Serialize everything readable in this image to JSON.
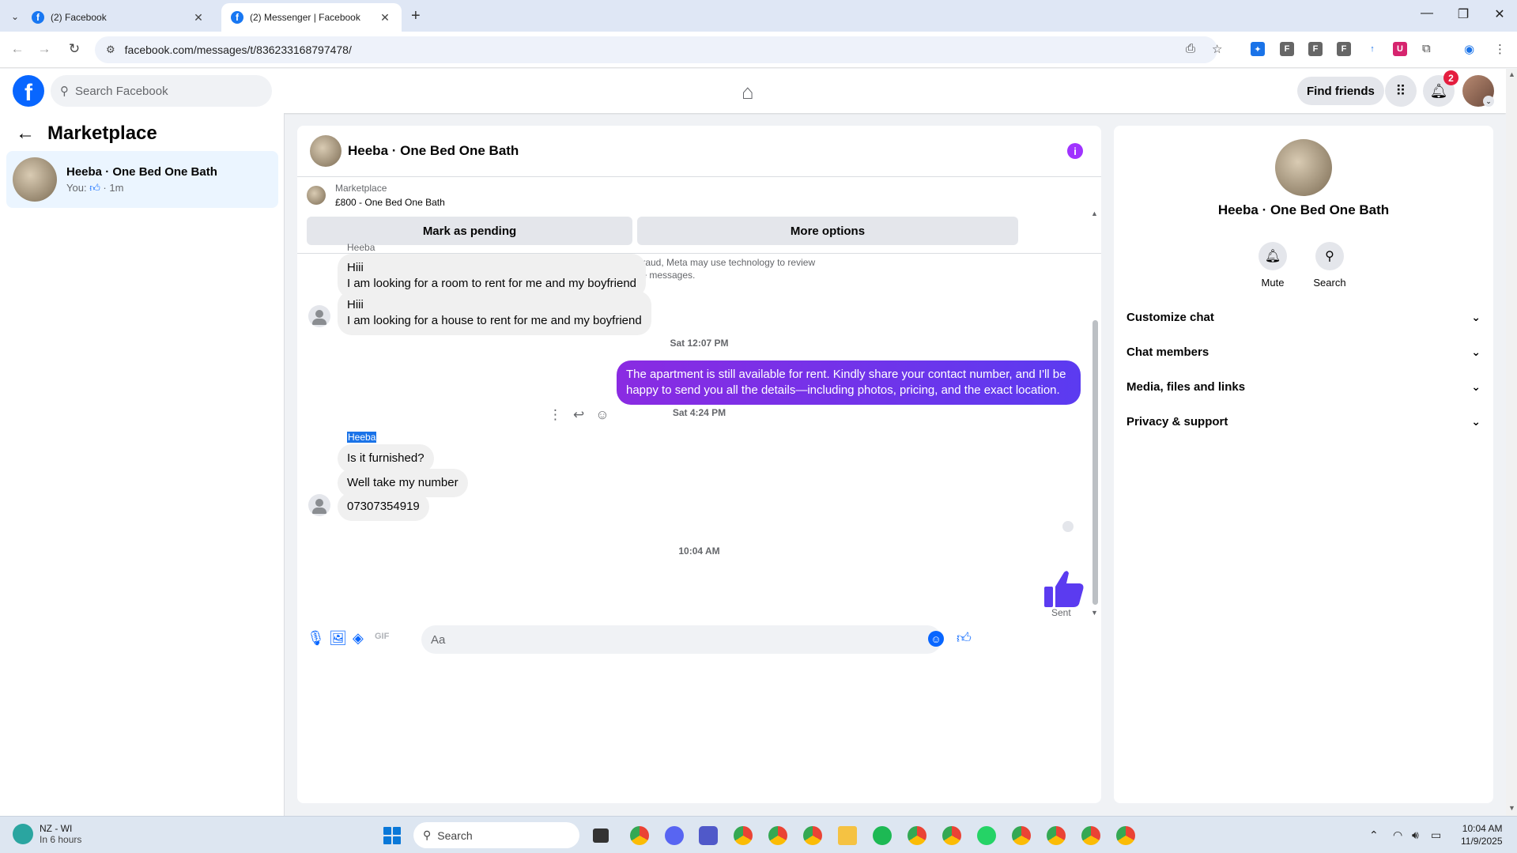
{
  "browser": {
    "tabs": [
      {
        "title": "(2) Facebook",
        "active": false
      },
      {
        "title": "(2) Messenger | Facebook",
        "active": true
      }
    ],
    "url": "facebook.com/messages/t/836233168797478/"
  },
  "fb_nav": {
    "search_placeholder": "Search Facebook",
    "find_friends_label": "Find friends",
    "notification_count": "2"
  },
  "left": {
    "title": "Marketplace",
    "conversation": {
      "name": "Heeba · One Bed One Bath",
      "preview_prefix": "You:",
      "preview_time": "· 1m"
    }
  },
  "chat": {
    "title": "Heeba · One Bed One Bath",
    "listing_label": "Marketplace",
    "listing_price": "£800 - One Bed One Bath",
    "mark_pending_label": "Mark as pending",
    "more_options_label": "More options",
    "notice": "To help identify and reduce scams and fraud, Meta may use technology to review Marketplace messages.",
    "sender1": "Heeba",
    "msg1_line1": "Hiii",
    "msg1_line2": "I am looking for a room to rent for me and my boyfriend",
    "msg2_line1": "Hiii",
    "msg2_line2": "I am looking for a house to rent for me and my boyfriend",
    "time1": "Sat 12:07 PM",
    "out_msg": "The apartment is still available for rent. Kindly share your contact number, and I'll be happy to send you all the details—including photos, pricing, and the exact location.",
    "time2": "Sat 4:24 PM",
    "sender2": "Heeba",
    "msg3": "Is it furnished?",
    "msg4": "Well take my number",
    "msg5": "07307354919",
    "time3": "10:04 AM",
    "sent_label": "Sent",
    "composer_placeholder": "Aa"
  },
  "right": {
    "name": "Heeba · One Bed One Bath",
    "mute_label": "Mute",
    "search_label": "Search",
    "rows": [
      "Customize chat",
      "Chat members",
      "Media, files and links",
      "Privacy & support"
    ]
  },
  "taskbar": {
    "weather_title": "NZ - WI",
    "weather_sub": "In 6 hours",
    "search_label": "Search",
    "time": "10:04 AM",
    "date": "11/9/2025"
  },
  "colors": {
    "brand": "#0866ff",
    "outgoing_bubble": "#7a33f0",
    "info": "#a033ff"
  }
}
